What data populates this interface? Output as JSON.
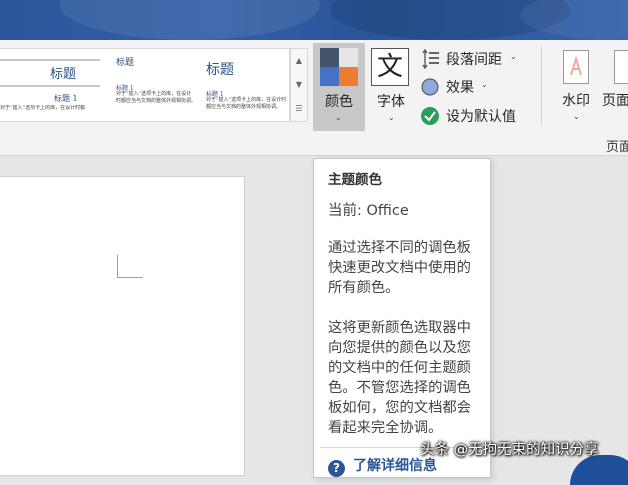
{
  "ribbon": {
    "style_gallery": {
      "items": [
        {
          "title": "标题",
          "subtitle": "标题 1",
          "text": "对于“插入”选项卡上的库，在设计时都"
        },
        {
          "title": "标题",
          "subtitle": "标题 1",
          "text": "对于“插入”选项卡上的库，在设计时都应当与文档的整体外观相协调。"
        },
        {
          "title": "标题",
          "subtitle": "标题 1",
          "text": "对于“插入”选项卡上的库，在设计时都应当与文档的整体外观相协调。"
        }
      ]
    },
    "colors_label": "颜色",
    "fonts_label": "字体",
    "fonts_glyph": "文",
    "paragraph_spacing_label": "段落间距",
    "effects_label": "效果",
    "set_default_label": "设为默认值",
    "watermark_label": "水印",
    "page_color_label": "页面",
    "group_label": "页面",
    "theme_colors": [
      "#44546a",
      "#e7e6e6",
      "#4472c4",
      "#ed7d31"
    ]
  },
  "tooltip": {
    "title": "主题颜色",
    "current": "当前: Office",
    "description1": "通过选择不同的调色板快速更改文档中使用的所有颜色。",
    "description2": "这将更新颜色选取器中向您提供的颜色以及您的文档中的任何主题颜色。不管您选择的调色板如何，您的文档都会看起来完全协调。",
    "link": "了解详细信息"
  },
  "credit": "头条 @无拘无束的知识分享",
  "accent_color": "#2b579a"
}
